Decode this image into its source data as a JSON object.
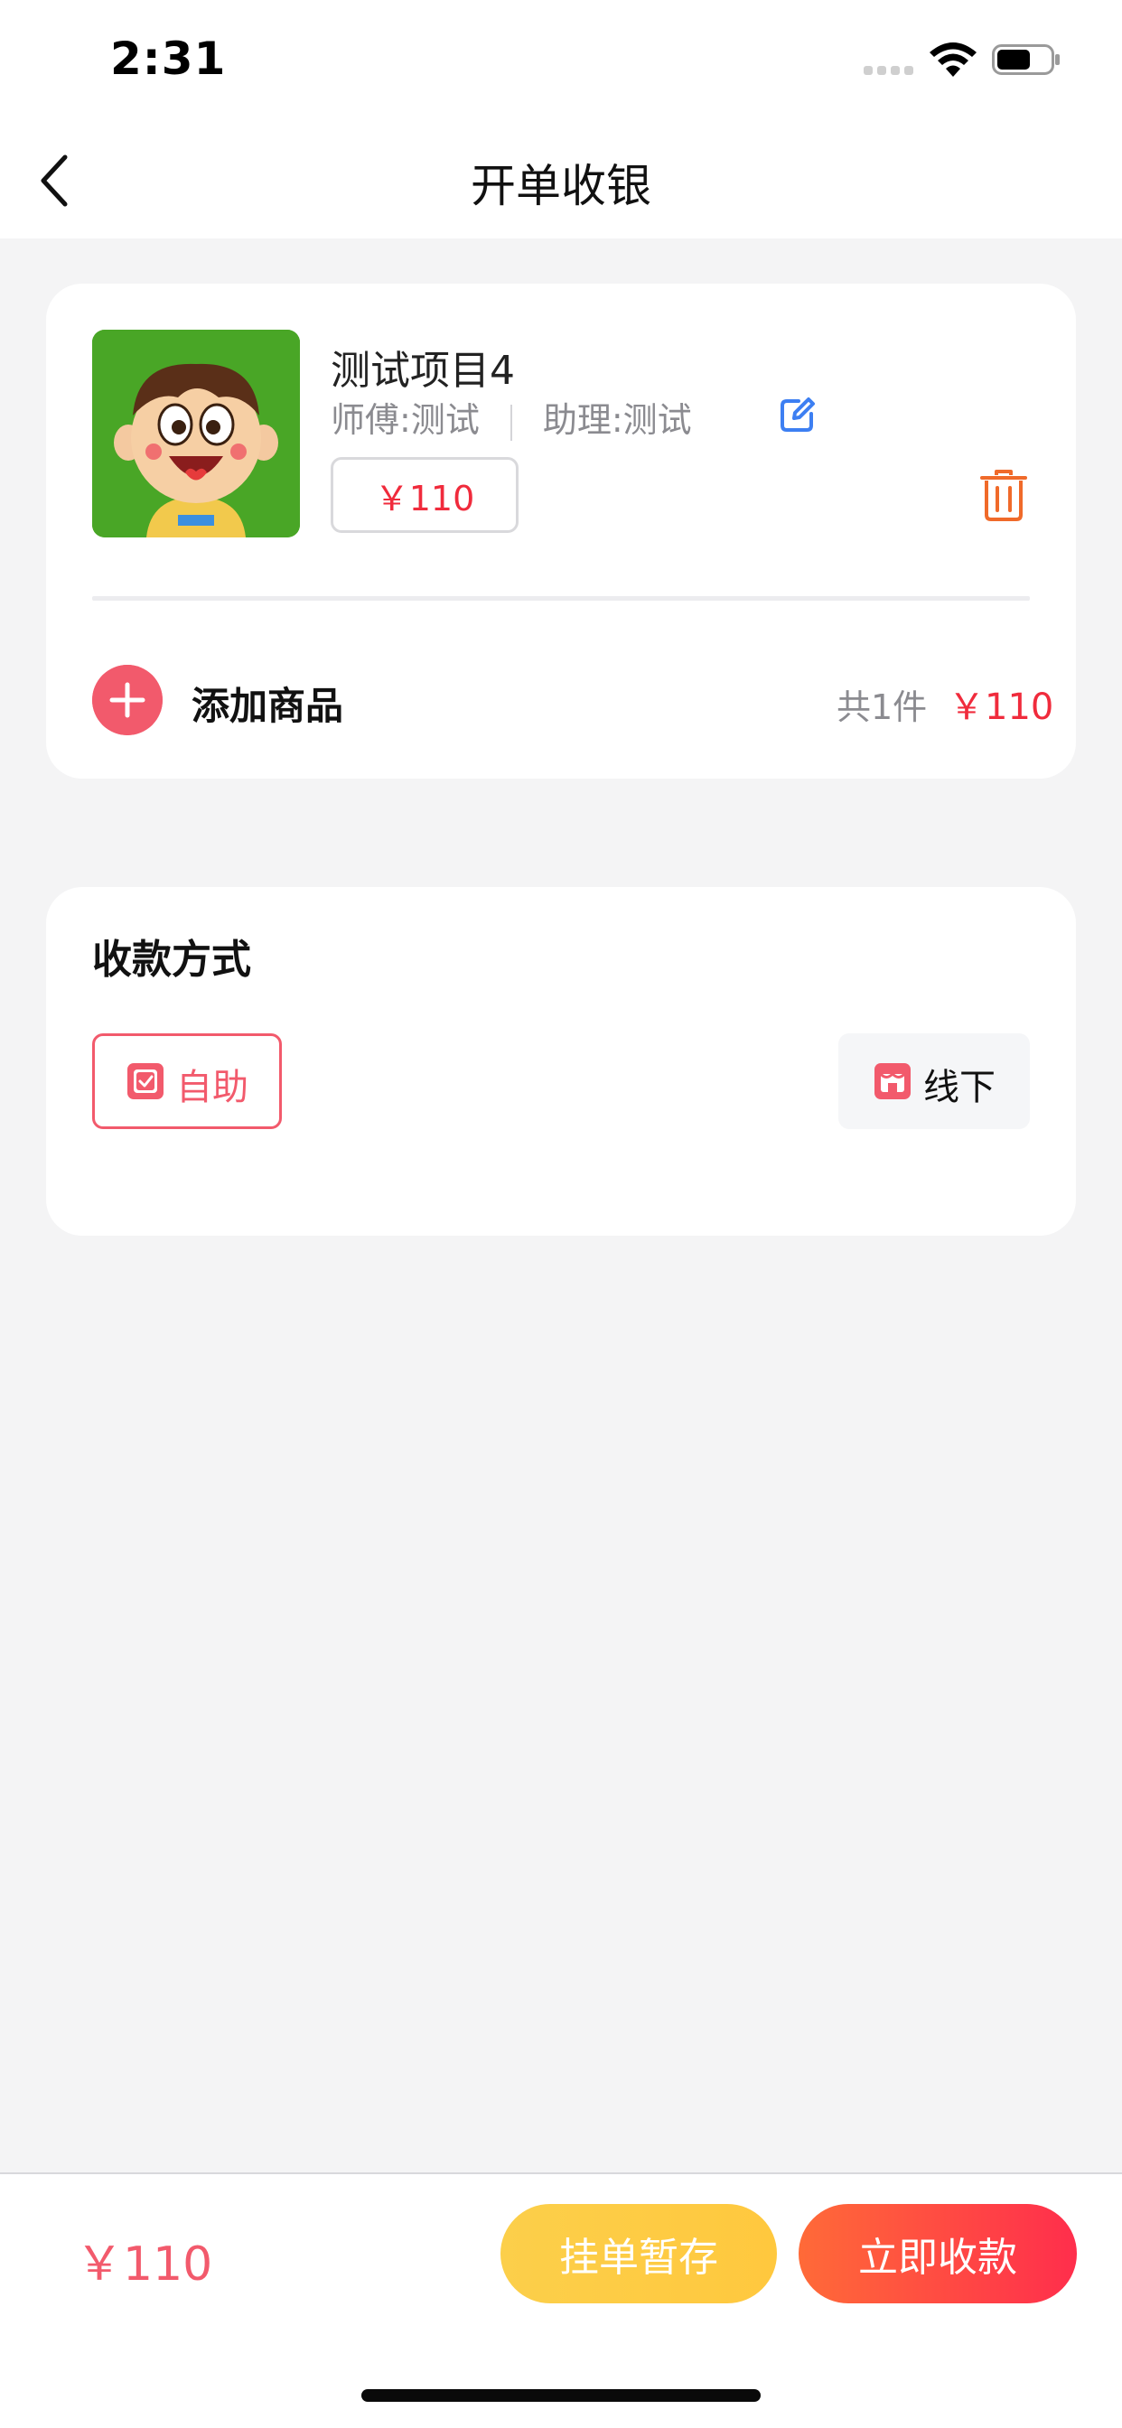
{
  "status_bar": {
    "time": "2:31"
  },
  "header": {
    "title": "开单收银"
  },
  "product": {
    "name": "测试项目4",
    "master_label": "师傅:",
    "master_value": "测试",
    "assistant_label": "助理:",
    "assistant_value": "测试",
    "price": "￥110"
  },
  "cart": {
    "add_label": "添加商品",
    "count": "共1件",
    "total": "￥110"
  },
  "payment": {
    "title": "收款方式",
    "options": [
      {
        "label": "自助",
        "selected": true
      },
      {
        "label": "线下",
        "selected": false
      }
    ]
  },
  "footer": {
    "total": "￥110",
    "hold_label": "挂单暂存",
    "pay_label": "立即收款"
  },
  "colors": {
    "accent_red": "#f02b3c",
    "accent_pink": "#f25a6c",
    "hold_yellow": "#fccf4a",
    "pay_gradient_start": "#ff6a38",
    "pay_gradient_end": "#ff2e4c",
    "edit_blue": "#3d7ff2",
    "trash_orange": "#f06a2a"
  },
  "icons": {
    "back": "chevron-left-icon",
    "edit": "edit-icon",
    "trash": "trash-icon",
    "add": "plus-icon",
    "self_pay": "checkbox-icon",
    "offline_pay": "store-icon"
  }
}
